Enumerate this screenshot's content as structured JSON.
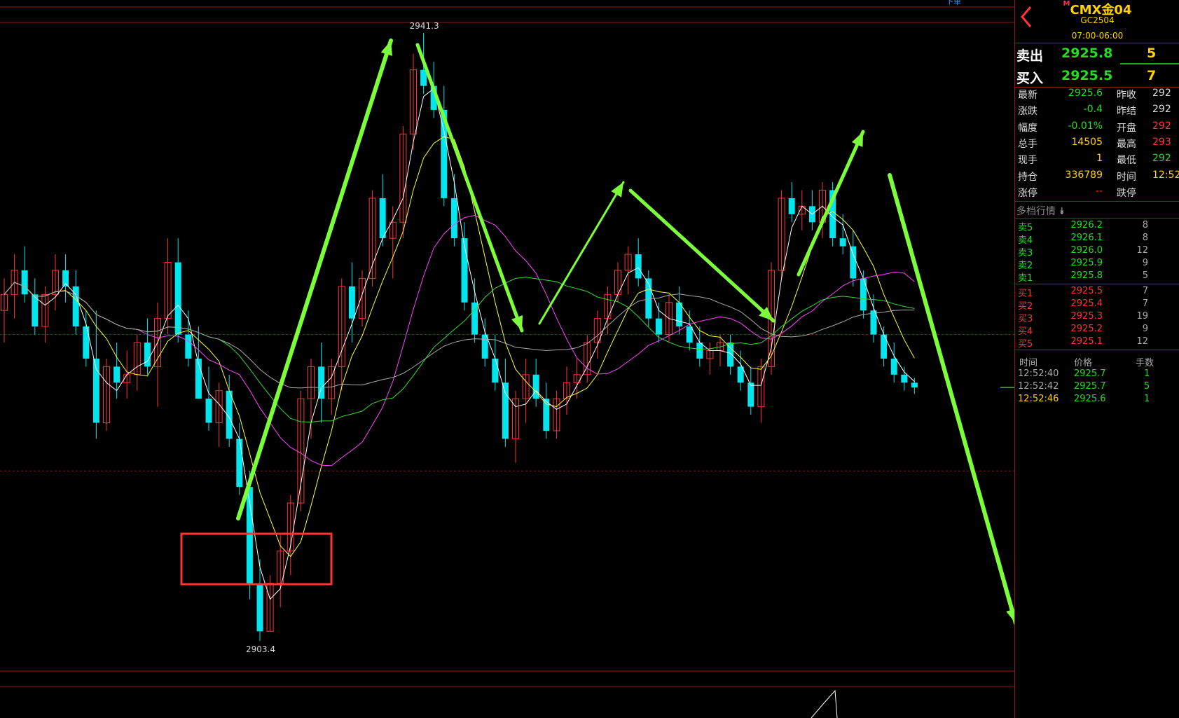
{
  "chart": {
    "high_label": "2941.3",
    "low_label": "2903.4",
    "top_right_label": "下单",
    "price_high": 2941.3,
    "price_low": 2903.4,
    "candles": [
      [
        2924.0,
        2926.0,
        2922.0,
        2925.0
      ],
      [
        2925.0,
        2927.5,
        2923.5,
        2926.5
      ],
      [
        2926.5,
        2928.0,
        2924.5,
        2925.0
      ],
      [
        2925.0,
        2926.0,
        2922.5,
        2923.0
      ],
      [
        2923.0,
        2925.5,
        2922.0,
        2925.0
      ],
      [
        2925.0,
        2927.5,
        2924.0,
        2926.5
      ],
      [
        2926.5,
        2927.5,
        2924.5,
        2925.5
      ],
      [
        2925.5,
        2926.5,
        2922.5,
        2923.0
      ],
      [
        2923.0,
        2924.0,
        2920.5,
        2921.0
      ],
      [
        2921.0,
        2924.0,
        2916.0,
        2917.0
      ],
      [
        2917.0,
        2921.0,
        2916.5,
        2920.5
      ],
      [
        2920.5,
        2922.0,
        2918.5,
        2919.5
      ],
      [
        2919.5,
        2921.5,
        2918.5,
        2920.0
      ],
      [
        2920.0,
        2922.5,
        2919.0,
        2922.0
      ],
      [
        2922.0,
        2923.5,
        2920.0,
        2920.5
      ],
      [
        2920.5,
        2924.5,
        2918.0,
        2923.5
      ],
      [
        2923.5,
        2928.5,
        2922.5,
        2927.0
      ],
      [
        2927.0,
        2928.5,
        2922.0,
        2922.5
      ],
      [
        2922.5,
        2924.0,
        2920.5,
        2921.0
      ],
      [
        2921.0,
        2923.0,
        2918.5,
        2918.5
      ],
      [
        2918.5,
        2920.5,
        2916.5,
        2917.0
      ],
      [
        2917.0,
        2919.5,
        2915.5,
        2919.0
      ],
      [
        2919.0,
        2920.0,
        2915.5,
        2916.0
      ],
      [
        2916.0,
        2917.0,
        2912.5,
        2913.0
      ],
      [
        2913.0,
        2914.0,
        2906.0,
        2907.0
      ],
      [
        2907.0,
        2908.5,
        2903.4,
        2904.0
      ],
      [
        2904.0,
        2907.5,
        2904.0,
        2907.0
      ],
      [
        2907.0,
        2910.0,
        2905.5,
        2909.0
      ],
      [
        2909.0,
        2912.5,
        2907.5,
        2912.0
      ],
      [
        2912.0,
        2919.0,
        2911.5,
        2918.5
      ],
      [
        2918.5,
        2921.0,
        2916.0,
        2920.5
      ],
      [
        2920.5,
        2922.0,
        2917.0,
        2918.5
      ],
      [
        2918.5,
        2921.0,
        2917.5,
        2920.5
      ],
      [
        2920.5,
        2926.0,
        2919.0,
        2925.5
      ],
      [
        2925.5,
        2927.0,
        2922.0,
        2923.5
      ],
      [
        2923.5,
        2926.5,
        2923.0,
        2926.0
      ],
      [
        2926.0,
        2931.5,
        2925.5,
        2931.0
      ],
      [
        2931.0,
        2932.5,
        2928.0,
        2928.5
      ],
      [
        2928.5,
        2930.5,
        2926.0,
        2929.5
      ],
      [
        2929.5,
        2935.5,
        2928.5,
        2935.0
      ],
      [
        2935.0,
        2940.0,
        2934.0,
        2939.0
      ],
      [
        2939.0,
        2941.3,
        2937.5,
        2938.0
      ],
      [
        2938.0,
        2939.5,
        2936.0,
        2936.5
      ],
      [
        2936.5,
        2938.0,
        2930.5,
        2931.0
      ],
      [
        2931.0,
        2932.5,
        2928.0,
        2928.5
      ],
      [
        2928.5,
        2929.5,
        2924.0,
        2924.5
      ],
      [
        2924.5,
        2926.0,
        2922.0,
        2922.5
      ],
      [
        2922.5,
        2923.5,
        2920.5,
        2921.0
      ],
      [
        2921.0,
        2922.5,
        2919.0,
        2919.5
      ],
      [
        2919.5,
        2921.0,
        2915.5,
        2916.0
      ],
      [
        2916.0,
        2919.0,
        2914.5,
        2918.5
      ],
      [
        2918.5,
        2921.0,
        2917.0,
        2920.0
      ],
      [
        2920.0,
        2921.0,
        2918.0,
        2918.5
      ],
      [
        2918.5,
        2919.5,
        2916.0,
        2916.5
      ],
      [
        2916.5,
        2919.0,
        2916.0,
        2918.5
      ],
      [
        2918.5,
        2920.5,
        2917.5,
        2919.5
      ],
      [
        2919.5,
        2921.0,
        2918.5,
        2920.0
      ],
      [
        2920.0,
        2922.5,
        2919.5,
        2922.0
      ],
      [
        2922.0,
        2924.0,
        2921.0,
        2923.5
      ],
      [
        2923.5,
        2925.5,
        2922.5,
        2925.0
      ],
      [
        2925.0,
        2927.0,
        2924.5,
        2926.5
      ],
      [
        2926.5,
        2928.0,
        2925.0,
        2927.5
      ],
      [
        2927.5,
        2928.5,
        2925.5,
        2926.0
      ],
      [
        2926.0,
        2926.5,
        2923.0,
        2923.5
      ],
      [
        2923.5,
        2924.5,
        2922.0,
        2922.5
      ],
      [
        2922.5,
        2925.0,
        2922.0,
        2924.5
      ],
      [
        2924.5,
        2925.5,
        2922.5,
        2923.0
      ],
      [
        2923.0,
        2924.0,
        2921.5,
        2922.0
      ],
      [
        2922.0,
        2923.0,
        2920.5,
        2921.0
      ],
      [
        2921.0,
        2922.0,
        2920.0,
        2921.5
      ],
      [
        2921.5,
        2922.5,
        2920.5,
        2922.0
      ],
      [
        2922.0,
        2922.5,
        2920.0,
        2920.5
      ],
      [
        2920.5,
        2921.5,
        2919.0,
        2919.5
      ],
      [
        2919.5,
        2920.5,
        2917.5,
        2918.0
      ],
      [
        2918.0,
        2921.0,
        2917.0,
        2920.5
      ],
      [
        2920.5,
        2927.0,
        2920.0,
        2926.5
      ],
      [
        2926.5,
        2931.5,
        2926.0,
        2931.0
      ],
      [
        2931.0,
        2932.0,
        2929.5,
        2930.0
      ],
      [
        2930.0,
        2931.5,
        2929.0,
        2930.5
      ],
      [
        2930.5,
        2931.5,
        2929.0,
        2929.5
      ],
      [
        2929.5,
        2932.0,
        2928.5,
        2931.5
      ],
      [
        2931.5,
        2932.0,
        2928.0,
        2928.5
      ],
      [
        2928.5,
        2930.0,
        2927.5,
        2928.0
      ],
      [
        2928.0,
        2929.0,
        2925.5,
        2926.0
      ],
      [
        2926.0,
        2926.5,
        2923.5,
        2924.0
      ],
      [
        2924.0,
        2925.0,
        2922.0,
        2922.5
      ],
      [
        2922.5,
        2923.0,
        2920.5,
        2921.0
      ],
      [
        2921.0,
        2922.0,
        2919.5,
        2920.0
      ],
      [
        2920.0,
        2920.5,
        2919.0,
        2919.5
      ],
      [
        2919.5,
        2919.8,
        2918.8,
        2919.2
      ]
    ],
    "ma_series": [
      {
        "name": "",
        "color": "#ffffff",
        "window": 3
      },
      {
        "name": "",
        "color": "#ffff33",
        "window": 6
      },
      {
        "name": "",
        "color": "#ff44ff",
        "window": 14
      },
      {
        "name": "",
        "color": "#33dd33",
        "window": 22
      },
      {
        "name": "",
        "color": "#aaaaaa",
        "window": 34
      }
    ]
  },
  "panel": {
    "title": "CMX金04",
    "title_mark": "M",
    "code": "GC2504",
    "session": "07:00-06:00",
    "sell_label": "卖出",
    "sell_price": "2925.8",
    "sell_vol": "5",
    "buy_label": "买入",
    "buy_price": "2925.5",
    "buy_vol": "7",
    "stats_left": [
      {
        "label": "最新",
        "value": "2925.6",
        "color": "#22dd22"
      },
      {
        "label": "涨跌",
        "value": "-0.4",
        "color": "#22dd22"
      },
      {
        "label": "幅度",
        "value": "-0.01%",
        "color": "#22dd22"
      },
      {
        "label": "总手",
        "value": "14505",
        "color": "#ffd200"
      },
      {
        "label": "现手",
        "value": "1",
        "color": "#ffd200"
      },
      {
        "label": "持仓",
        "value": "336789",
        "color": "#ffd200"
      },
      {
        "label": "涨停",
        "value": "--",
        "color": "#ff3333"
      }
    ],
    "stats_right": [
      {
        "label": "昨收",
        "value": "292",
        "color": "#dddddd"
      },
      {
        "label": "昨结",
        "value": "292",
        "color": "#dddddd"
      },
      {
        "label": "开盘",
        "value": "292",
        "color": "#ff3333"
      },
      {
        "label": "最高",
        "value": "293",
        "color": "#ff3333"
      },
      {
        "label": "最低",
        "value": "292",
        "color": "#22dd22"
      },
      {
        "label": "时间",
        "value": "12:52",
        "color": "#ffd200"
      },
      {
        "label": "跌停",
        "value": "",
        "color": "#22dd22"
      }
    ],
    "depth_title": "多档行情",
    "asks": [
      {
        "label": "卖5",
        "price": "2926.2",
        "vol": "8"
      },
      {
        "label": "卖4",
        "price": "2926.1",
        "vol": "8"
      },
      {
        "label": "卖3",
        "price": "2926.0",
        "vol": "12"
      },
      {
        "label": "卖2",
        "price": "2925.9",
        "vol": "9"
      },
      {
        "label": "卖1",
        "price": "2925.8",
        "vol": "5"
      }
    ],
    "bids": [
      {
        "label": "买1",
        "price": "2925.5",
        "vol": "7"
      },
      {
        "label": "买2",
        "price": "2925.4",
        "vol": "7"
      },
      {
        "label": "买3",
        "price": "2925.3",
        "vol": "19"
      },
      {
        "label": "买4",
        "price": "2925.2",
        "vol": "9"
      },
      {
        "label": "买5",
        "price": "2925.1",
        "vol": "12"
      }
    ],
    "trades_header": {
      "time": "时间",
      "price": "价格",
      "vol": "手数"
    },
    "trades": [
      {
        "time": "12:52:40",
        "price": "2925.7",
        "vol": "1"
      },
      {
        "time": "12:52:42",
        "price": "2925.7",
        "vol": "5"
      },
      {
        "time": "12:52:46",
        "price": "2925.6",
        "vol": "1"
      }
    ]
  },
  "colors": {
    "up": "#ff3333",
    "down": "#00e5ee",
    "arrow": "#7cff3a",
    "box": "#ff3333",
    "grid": "#8b1a1a",
    "green_text": "#22dd22",
    "yellow_text": "#ffd200"
  }
}
